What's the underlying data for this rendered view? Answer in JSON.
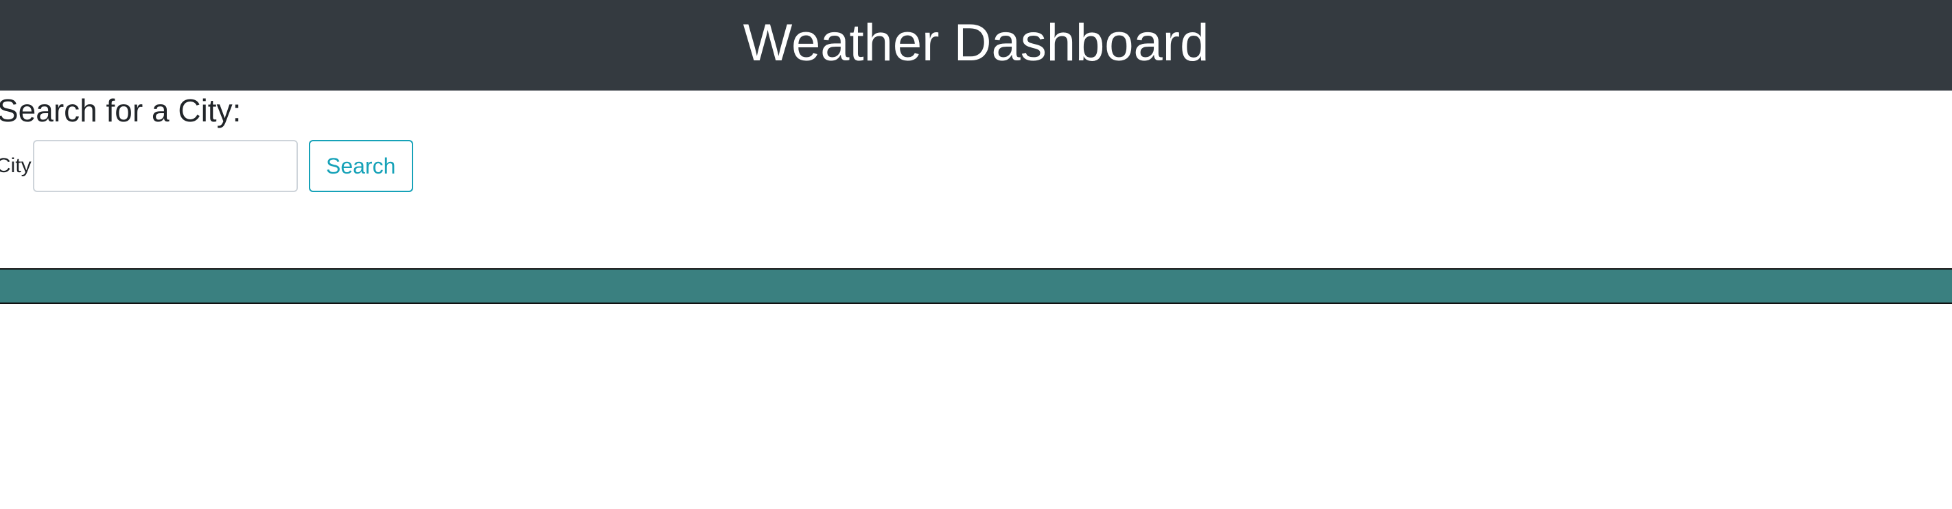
{
  "header": {
    "title": "Weather Dashboard"
  },
  "search": {
    "heading": "Search for a City:",
    "city_label": "City",
    "city_value": "",
    "button_label": "Search"
  },
  "colors": {
    "header_bg": "#343a40",
    "accent": "#17a2b8",
    "band": "#3a8080"
  }
}
